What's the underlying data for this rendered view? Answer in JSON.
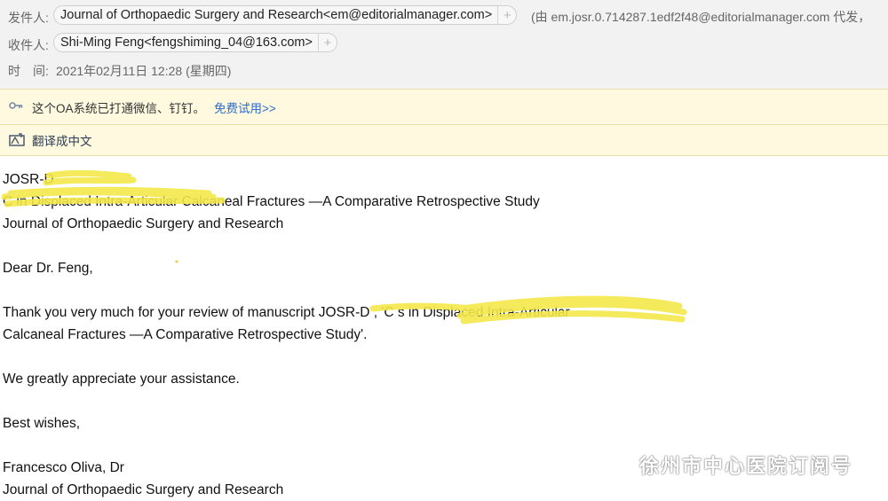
{
  "header": {
    "from_label": "发件人:",
    "from_chip": "Journal of Orthopaedic Surgery and Research<em@editorialmanager.com>",
    "from_proxy": "(由 em.josr.0.714287.1edf2f48@editorialmanager.com 代发，",
    "to_label": "收件人:",
    "to_chip": "Shi-Ming Feng<fengshiming_04@163.com>",
    "add_symbol": "+",
    "time_label": "时　间:",
    "time_value": "2021年02月11日 12:28 (星期四)"
  },
  "banners": {
    "oa_text": "这个OA系统已打通微信、钉钉。",
    "oa_link": "免费试用>>",
    "translate_text": "翻译成中文"
  },
  "email": {
    "line1": "JOSR-D",
    "line2": "C                                   in Displaced Intra-Articular Calcaneal Fractures —A Comparative Retrospective Study",
    "line3": "Journal of Orthopaedic Surgery and Research",
    "greeting": "Dear Dr. Feng,",
    "para1_line1": "Thank you very much for your review of manuscript JOSR-D          , 'C                                      s in Displaced Intra-Articular",
    "para1_line2": "Calcaneal Fractures —A Comparative Retrospective Study'.",
    "para2": "We greatly appreciate your assistance.",
    "closing": "Best wishes,",
    "signature_name": "Francesco Oliva, Dr",
    "signature_org": "Journal of Orthopaedic Surgery and Research"
  },
  "watermark": {
    "text": "徐州市中心医院订阅号",
    "icon": "wechat-icon"
  },
  "colors": {
    "header_bg": "#f2f2f2",
    "banner_bg": "#fffadf",
    "link": "#2d6bc9",
    "highlight": "#f3e84a"
  }
}
